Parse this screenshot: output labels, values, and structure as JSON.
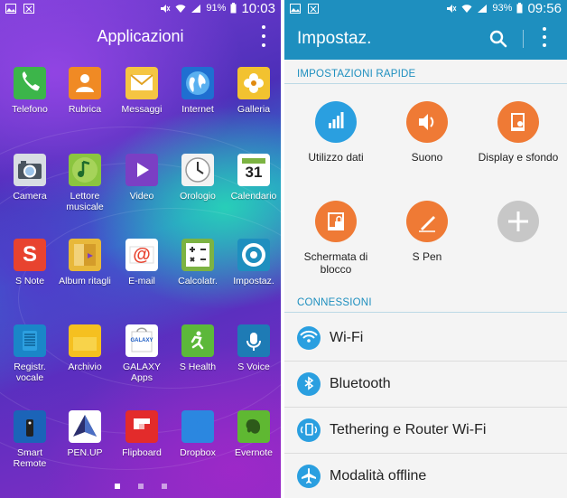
{
  "left": {
    "status": {
      "battery": "91%",
      "time": "10:03"
    },
    "title": "Applicazioni",
    "apps": [
      {
        "label": "Telefono",
        "icon": "phone-icon",
        "color": "#3cb54a"
      },
      {
        "label": "Rubrica",
        "icon": "contacts-icon",
        "color": "#f08a24"
      },
      {
        "label": "Messaggi",
        "icon": "messages-icon",
        "color": "#f5c542"
      },
      {
        "label": "Internet",
        "icon": "internet-globe-icon",
        "color": "#1f6fd1"
      },
      {
        "label": "Galleria",
        "icon": "gallery-flower-icon",
        "color": "#f2c230"
      },
      {
        "label": "Camera",
        "icon": "camera-icon",
        "color": "#d8dde3"
      },
      {
        "label": "Lettore musicale",
        "icon": "music-player-icon",
        "color": "#8bc53f"
      },
      {
        "label": "Video",
        "icon": "video-play-icon",
        "color": "#7b3fc4"
      },
      {
        "label": "Orologio",
        "icon": "clock-icon",
        "color": "#f2f2f2"
      },
      {
        "label": "Calendario",
        "icon": "calendar-icon",
        "color": "#ffffff",
        "text": "31"
      },
      {
        "label": "S Note",
        "icon": "s-note-icon",
        "color": "#e8432f",
        "text": "S"
      },
      {
        "label": "Album ritagli",
        "icon": "scrapbook-icon",
        "color": "#e8b83a"
      },
      {
        "label": "E-mail",
        "icon": "email-icon",
        "color": "#ffffff",
        "text": "@"
      },
      {
        "label": "Calcolatr.",
        "icon": "calculator-icon",
        "color": "#7cb342"
      },
      {
        "label": "Impostaz.",
        "icon": "settings-gear-icon",
        "color": "#1e8fbf"
      },
      {
        "label": "Registr. vocale",
        "icon": "voice-recorder-icon",
        "color": "#1a86c8"
      },
      {
        "label": "Archivio",
        "icon": "folder-icon",
        "color": "#f5c020"
      },
      {
        "label": "GALAXY Apps",
        "icon": "galaxy-apps-bag-icon",
        "color": "#ffffff",
        "text": "GALAXY"
      },
      {
        "label": "S Health",
        "icon": "s-health-icon",
        "color": "#5cb83a"
      },
      {
        "label": "S Voice",
        "icon": "s-voice-mic-icon",
        "color": "#1e7bb5"
      },
      {
        "label": "Smart Remote",
        "icon": "smart-remote-icon",
        "color": "#1b64b8"
      },
      {
        "label": "PEN.UP",
        "icon": "pen-up-icon",
        "color": "#ffffff"
      },
      {
        "label": "Flipboard",
        "icon": "flipboard-icon",
        "color": "#e32b2b"
      },
      {
        "label": "Dropbox",
        "icon": "dropbox-icon",
        "color": "#2b87e0"
      },
      {
        "label": "Evernote",
        "icon": "evernote-elephant-icon",
        "color": "#5fb832"
      }
    ]
  },
  "right": {
    "status": {
      "battery": "93%",
      "time": "09:56"
    },
    "title": "Impostaz.",
    "quick_header": "IMPOSTAZIONI RAPIDE",
    "quick": [
      {
        "label": "Utilizzo dati",
        "icon": "data-usage-icon",
        "style": "blue"
      },
      {
        "label": "Suono",
        "icon": "sound-speaker-icon",
        "style": "orange"
      },
      {
        "label": "Display e sfondo",
        "icon": "display-wallpaper-icon",
        "style": "orange"
      },
      {
        "label": "Schermata di blocco",
        "icon": "lock-screen-icon",
        "style": "orange"
      },
      {
        "label": "S Pen",
        "icon": "s-pen-icon",
        "style": "orange"
      },
      {
        "label": "",
        "icon": "add-plus-icon",
        "style": "gray"
      }
    ],
    "conn_header": "CONNESSIONI",
    "connections": [
      {
        "label": "Wi-Fi",
        "icon": "wifi-icon"
      },
      {
        "label": "Bluetooth",
        "icon": "bluetooth-icon"
      },
      {
        "label": "Tethering e Router Wi-Fi",
        "icon": "tethering-icon"
      },
      {
        "label": "Modalità offline",
        "icon": "airplane-icon"
      }
    ],
    "accent": "#1e8fbf"
  }
}
